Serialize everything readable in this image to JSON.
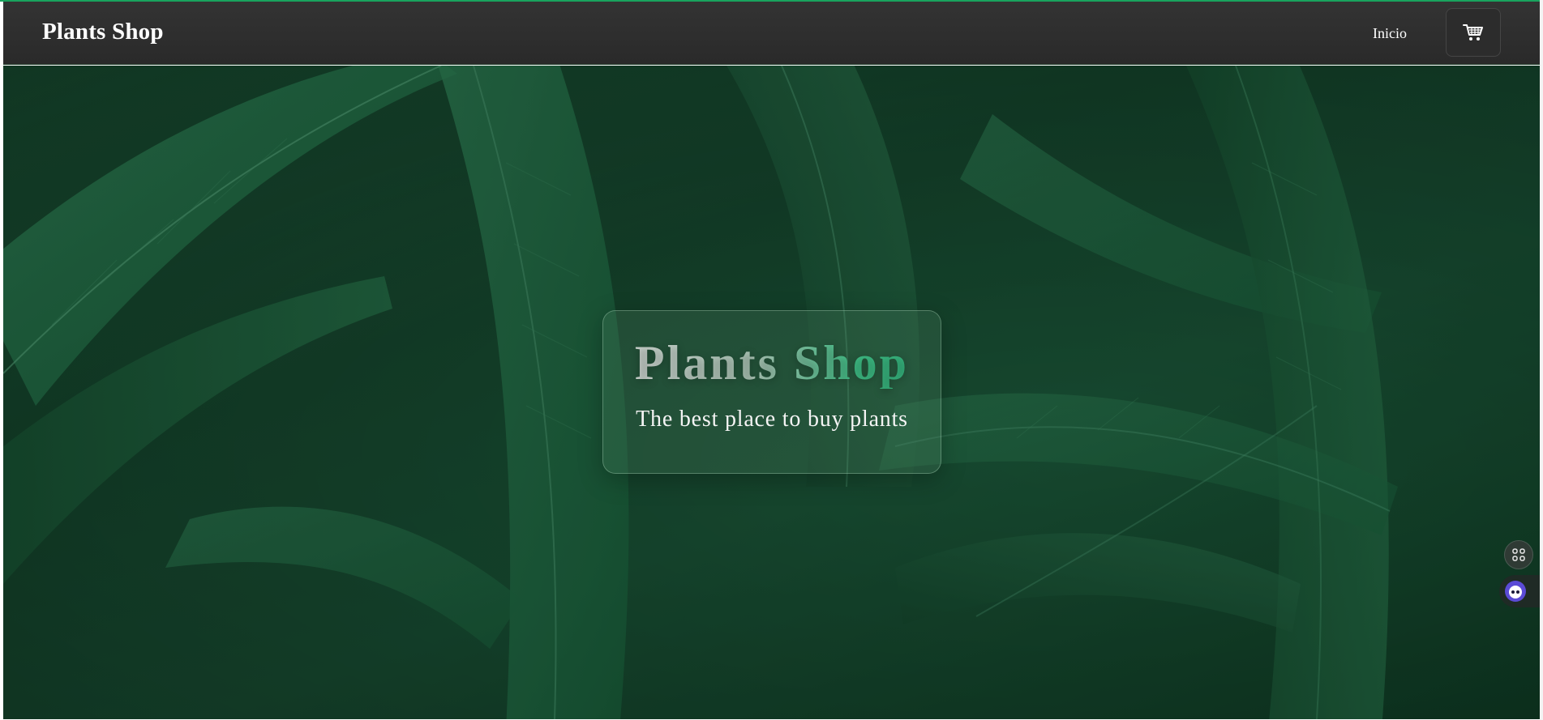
{
  "nav": {
    "brand": "Plants Shop",
    "links": [
      "Inicio"
    ],
    "cart_icon": "shopping-cart-icon"
  },
  "hero": {
    "title": "Plants Shop",
    "subtitle": "The best place to buy plants"
  },
  "floating": {
    "shortcut_icon": "command-icon",
    "assistant_icon": "assistant-bot-icon"
  },
  "colors": {
    "accent": "#19a35e",
    "navbar": "#2f2f2f",
    "hero_green": "#1a5236",
    "title_green": "#2fae78"
  }
}
